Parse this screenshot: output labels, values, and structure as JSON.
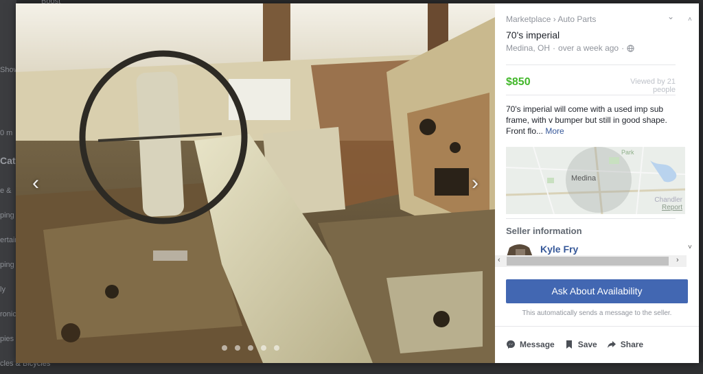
{
  "background": {
    "top_text": "Boost",
    "left_texts": [
      "Show",
      "0 m",
      "Cat",
      "e &",
      "ping",
      "ertain",
      "ping",
      "ly",
      "ronic",
      "pies",
      "cles & Bicycles"
    ]
  },
  "photo": {
    "prev_icon": "chevron-left-icon",
    "next_icon": "chevron-right-icon",
    "image_count": 5
  },
  "listing": {
    "breadcrumb": "Marketplace › Auto Parts",
    "title": "70's imperial",
    "location": "Medina, OH",
    "time_ago": "over a week ago",
    "separator": "·",
    "price": "$850",
    "views": "Viewed by 21 people",
    "description": "70's imperial will come with a used imp sub frame, with v bumper but still in good shape. Front flo...",
    "more_link": "More"
  },
  "map": {
    "city_label": "Medina",
    "park_label": "Park",
    "corner_city": "Chandler",
    "report_link": "Report"
  },
  "seller": {
    "heading": "Seller information",
    "name": "Kyle Fry"
  },
  "cta": {
    "button": "Ask About Availability",
    "note": "This automatically sends a message to the seller."
  },
  "actions": {
    "message": "Message",
    "save": "Save",
    "share": "Share"
  },
  "colors": {
    "price_green": "#42b72a",
    "link_blue": "#365899",
    "cta_blue": "#4267b2"
  }
}
